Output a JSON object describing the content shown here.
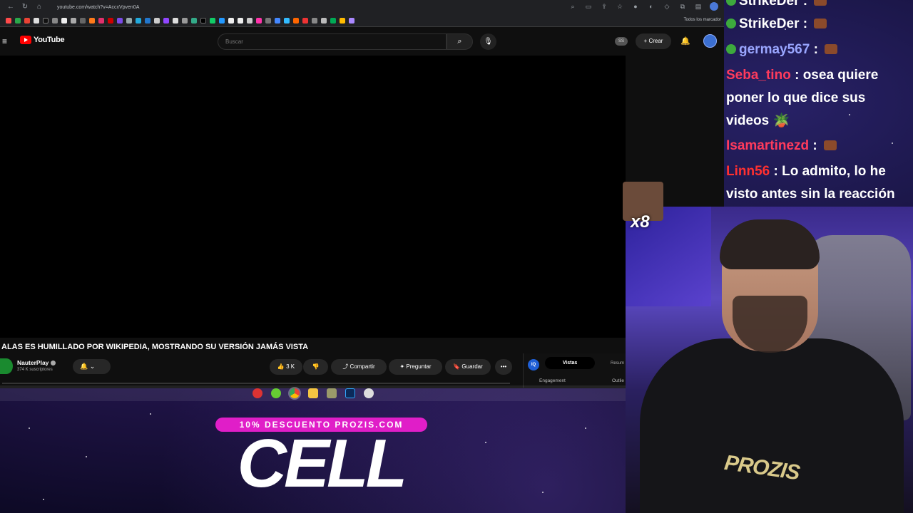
{
  "browser": {
    "url": "youtube.com/watch?v=AccxVpven0A",
    "all_bookmarks": "Todos los marcador"
  },
  "youtube": {
    "logo_text": "YouTube",
    "search_placeholder": "Buscar",
    "create_label": "Crear",
    "ss_badge": "SS",
    "video_title": "ALAS ES HUMILLADO POR WIKIPEDIA, MOSTRANDO SU VERSIÓN JAMÁS VISTA",
    "channel_name": "NauterPlay",
    "subscribers": "374 K suscriptores",
    "like_count": "3 K",
    "share_label": "Compartir",
    "ask_label": "Preguntar",
    "save_label": "Guardar",
    "more_label": "•••",
    "analytics": {
      "logo": "IQ",
      "tab_active": "Vistas",
      "tab_other": "Resum",
      "label_engagement": "Engagement",
      "label_outlier": "Outlie"
    }
  },
  "promo": {
    "discount": "10% DESCUENTO PROZIS.COM",
    "brand": "CELL"
  },
  "chat": {
    "messages": [
      {
        "user": "StrikeDer",
        "text": "",
        "user_color": "#ffffff",
        "badge": true,
        "emote": true
      },
      {
        "user": "StrikeDer",
        "text": "",
        "user_color": "#ffffff",
        "badge": true,
        "emote": true
      },
      {
        "user": "germay567",
        "text": "",
        "user_color": "#9aa6ff",
        "badge": true,
        "emote": true
      },
      {
        "user": "Seba_tino",
        "text": "osea quiere poner lo que dice sus videos",
        "user_color": "#ff3b5c",
        "badge": false,
        "emote": false
      },
      {
        "user": "Isamartinezd",
        "text": "",
        "user_color": "#ff3b5c",
        "badge": false,
        "emote": true
      },
      {
        "user": "Linn56",
        "text": "Lo admito, lo he visto antes sin la reacción",
        "user_color": "#ff3030",
        "badge": false,
        "emote": false
      }
    ]
  },
  "overlay": {
    "emote_multiplier": "x8"
  },
  "webcam": {
    "shirt_text": "PROZIS"
  },
  "colors": {
    "youtube_red": "#ff0000",
    "promo_pink": "#e01ec8",
    "chat_badge_green": "#3da93d"
  }
}
